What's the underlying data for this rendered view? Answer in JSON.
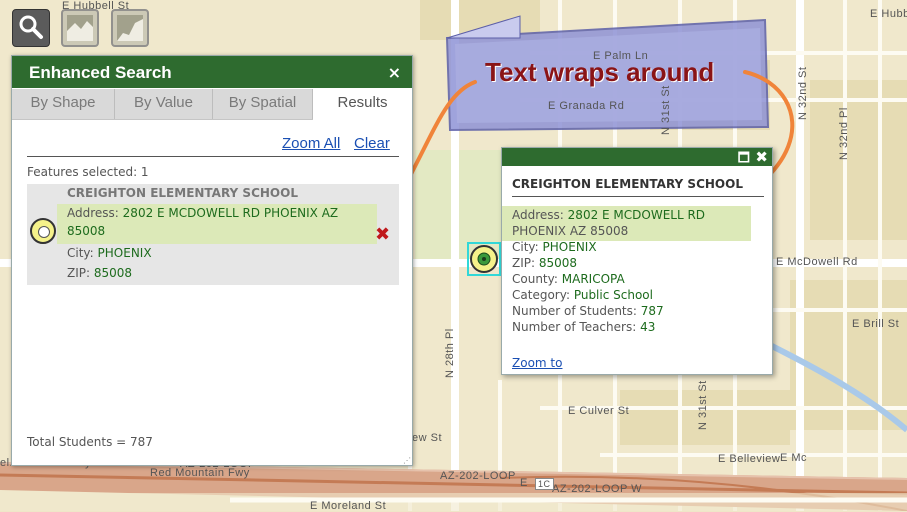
{
  "map": {
    "streets": {
      "e_hubbell": "E Hubbell St",
      "e_hubb_right": "E Hubb",
      "e_palm": "E Palm Ln",
      "e_granada": "E Granada Rd",
      "n_31st": "N 31st St",
      "n_32nd": "N 32nd St",
      "n_32nd_pl": "N 32nd Pl",
      "e_mcdowell": "E McDowell Rd",
      "e_brill": "E Brill St",
      "n_28th": "N 28th Pl",
      "e_culver": "E Culver St",
      "w_st": "ew St",
      "red_mountain_1": "el. Mountain Fwy",
      "red_mountain_2": "Red Mountain Fwy",
      "az202_1": "AZ-202-LOOP",
      "az202_2": "AZ-202-LOOP",
      "az202_3": "AZ-202-LOOP  W",
      "loop_e": "E",
      "loop_w": "W",
      "e_belleview": "E Belleview",
      "e_moreland": "E Moreland St",
      "e_mc": "E Mc",
      "road_1c": "1C"
    }
  },
  "toolbar": {
    "search_icon": "search-icon",
    "profile_icon": "profile-chart-icon",
    "elevation_icon": "elevation-chart-icon"
  },
  "panel": {
    "title": "Enhanced Search",
    "close": "×",
    "tabs": {
      "shape": "By Shape",
      "value": "By Value",
      "spatial": "By Spatial",
      "results": "Results"
    },
    "zoom_all": "Zoom All",
    "clear": "Clear",
    "features_selected": "Features selected: 1",
    "result": {
      "name": "CREIGHTON ELEMENTARY SCHOOL",
      "address_label": "Address:",
      "address_line1": "2802 E MCDOWELL RD PHOENIX AZ",
      "address_line2": "85008",
      "city_label": "City:",
      "city": "PHOENIX",
      "zip_label": "ZIP:",
      "zip": "85008",
      "remove": "✖"
    },
    "total_students": "Total Students = 787"
  },
  "popup": {
    "maximize": "🗖",
    "close": "✖",
    "title": "CREIGHTON ELEMENTARY SCHOOL",
    "address_label": "Address:",
    "address_line1": "2802 E MCDOWELL RD",
    "address_line2": "PHOENIX AZ 85008",
    "city_label": "City:",
    "city": "PHOENIX",
    "zip_label": "ZIP:",
    "zip": "85008",
    "county_label": "County:",
    "county": "MARICOPA",
    "category_label": "Category:",
    "category": "Public School",
    "students_label": "Number of Students:",
    "students": "787",
    "teachers_label": "Number of Teachers:",
    "teachers": "43",
    "zoom_to": "Zoom to"
  },
  "callout": {
    "text": "Text wraps around"
  },
  "colors": {
    "panel_header": "#2e6b2f",
    "value_text": "#1d6b1d",
    "highlight": "#dce9b8",
    "link": "#1a4fb3",
    "callout_text": "#8a1416",
    "arrow": "#f0843a"
  }
}
